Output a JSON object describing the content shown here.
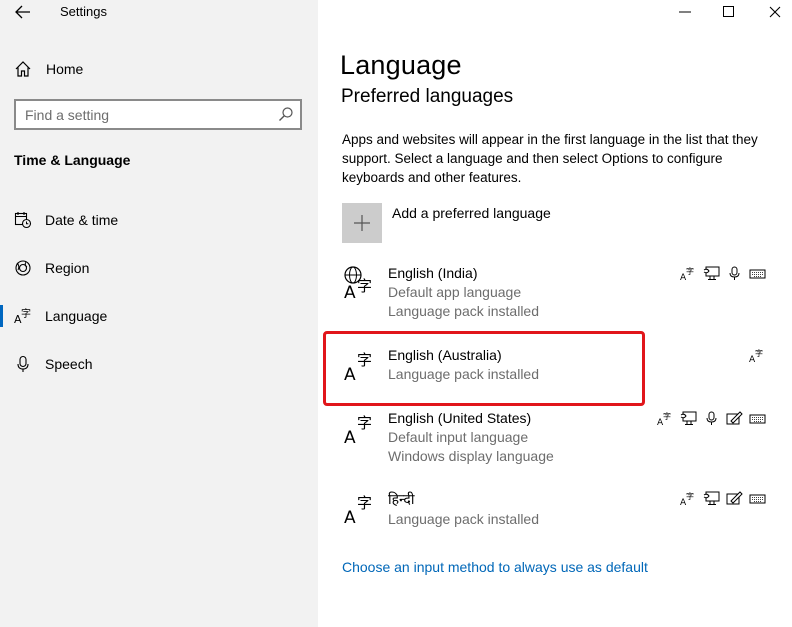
{
  "window": {
    "title": "Settings"
  },
  "sidebar": {
    "home_label": "Home",
    "search_placeholder": "Find a setting",
    "section_title": "Time & Language",
    "items": [
      {
        "label": "Date & time",
        "icon": "calendar-clock-icon",
        "active": false
      },
      {
        "label": "Region",
        "icon": "globe-region-icon",
        "active": false
      },
      {
        "label": "Language",
        "icon": "language-icon",
        "active": true
      },
      {
        "label": "Speech",
        "icon": "microphone-icon",
        "active": false
      }
    ]
  },
  "main": {
    "title": "Language",
    "subtitle": "Preferred languages",
    "description": "Apps and websites will appear in the first language in the list that they support. Select a language and then select Options to configure keyboards and other features.",
    "add_language_label": "Add a preferred language",
    "languages": [
      {
        "name": "English (India)",
        "details": [
          "Default app language",
          "Language pack installed"
        ],
        "features": [
          "display-language-icon",
          "text-to-speech-icon",
          "speech-recognition-icon",
          "keyboard-icon"
        ]
      },
      {
        "name": "English (Australia)",
        "details": [
          "Language pack installed"
        ],
        "features": [
          "display-language-icon"
        ],
        "highlighted": true
      },
      {
        "name": "English (United States)",
        "details": [
          "Default input language",
          "Windows display language"
        ],
        "features": [
          "display-language-icon",
          "text-to-speech-icon",
          "speech-recognition-icon",
          "handwriting-icon",
          "keyboard-icon"
        ]
      },
      {
        "name": "हिन्दी",
        "details": [
          "Language pack installed"
        ],
        "features": [
          "display-language-icon",
          "text-to-speech-icon",
          "handwriting-icon",
          "keyboard-icon"
        ]
      }
    ],
    "input_method_link": "Choose an input method to always use as default"
  },
  "colors": {
    "accent": "#0067c0",
    "link": "#0067b8",
    "highlight": "#e1161b",
    "sidebar_bg": "#f2f2f2",
    "secondary_text": "#6d6d6d"
  }
}
